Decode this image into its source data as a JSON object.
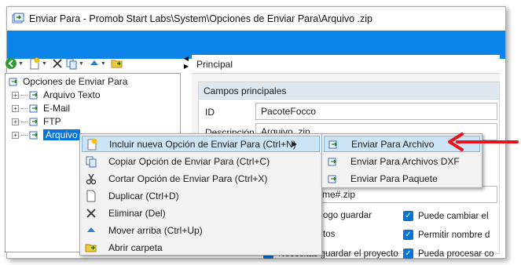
{
  "window": {
    "title": "Enviar Para - Promob Start Labs\\System\\Opciones de Enviar Para\\Arquivo .zip"
  },
  "colors": {
    "ribbon": "#0a84e8",
    "selection": "#0a73d6",
    "menu_highlight": "#cde4f7",
    "annotation": "#e8141b"
  },
  "toolbar": {
    "icons": [
      "refresh-icon",
      "new-icon",
      "delete-icon",
      "copy-icon",
      "move-up-icon",
      "open-folder-icon"
    ]
  },
  "tree": {
    "root": "Opciones de Enviar Para",
    "children": [
      "Arquivo Texto",
      "E-Mail",
      "FTP",
      "Arquivo"
    ]
  },
  "right": {
    "header": "Principal",
    "group_title": "Campos principales",
    "id_label": "ID",
    "id_value": "PacoteFocco",
    "desc_label": "Descripción",
    "desc_value": "Arquivo .zip",
    "partial_value": "me#.zip",
    "checks_left": [
      "ogo guardar",
      "tos",
      "Necesitas guardar el proyecto"
    ],
    "checks_right": [
      "Puede cambiar el",
      "Permitir nombre d",
      "Pueda procesar co"
    ]
  },
  "context_menu": {
    "items": [
      "Incluir nueva Opción de Enviar Para (Ctrl+N)",
      "Copiar Opción de Enviar Para (Ctrl+C)",
      "Cortar Opción de Enviar Para (Ctrl+X)",
      "Duplicar (Ctrl+D)",
      "Eliminar (Del)",
      "Mover arriba (Ctrl+Up)",
      "Abrir carpeta"
    ]
  },
  "submenu": {
    "items": [
      "Enviar Para Archivo",
      "Enviar Para Archivos DXF",
      "Enviar Para Paquete"
    ]
  }
}
